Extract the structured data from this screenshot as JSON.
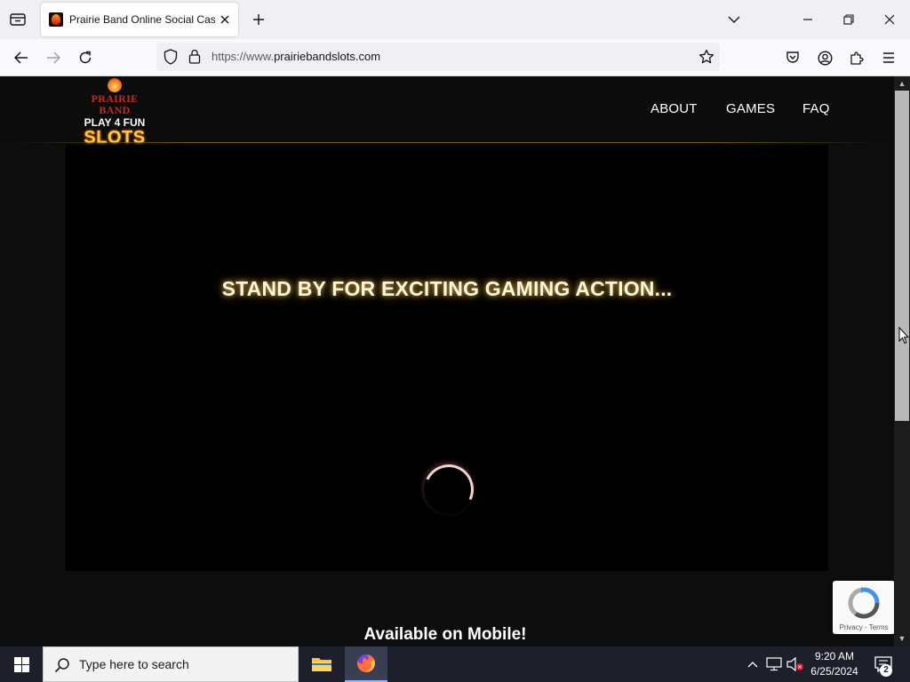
{
  "browser": {
    "tab_title": "Prairie Band Online Social Casino",
    "url_prefix": "https://www.",
    "url_host": "prairiebandslots.com"
  },
  "site": {
    "logo": {
      "line1": "PRAIRIE BAND",
      "line2": "PLAY 4 FUN",
      "line3": "SLOTS"
    },
    "nav": [
      "ABOUT",
      "GAMES",
      "FAQ"
    ],
    "headline": "STAND BY FOR EXCITING GAMING ACTION...",
    "mobile_heading": "Available on Mobile!",
    "recaptcha": {
      "privacy": "Privacy",
      "separator": " - ",
      "terms": "Terms"
    }
  },
  "taskbar": {
    "search_placeholder": "Type here to search",
    "time": "9:20 AM",
    "date": "6/25/2024",
    "notification_count": "2"
  },
  "colors": {
    "headline_glow": "#c8a24a",
    "logo_red": "#c62828",
    "logo_gold": "#f7c948"
  }
}
